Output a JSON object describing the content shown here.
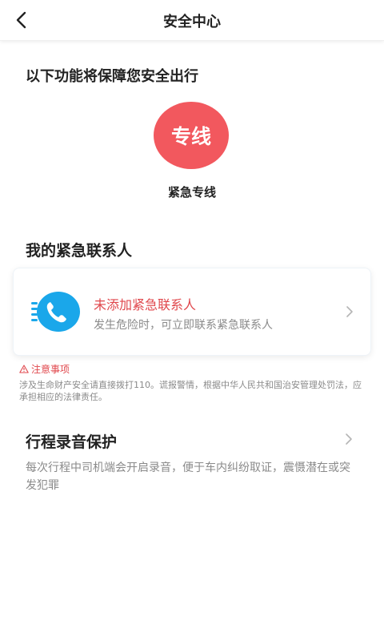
{
  "header": {
    "title": "安全中心",
    "back_icon": "chevron-left-icon"
  },
  "features": {
    "heading": "以下功能将保障您安全出行",
    "hotline": {
      "badge_text": "专线",
      "label": "紧急专线",
      "color": "#f2585e"
    }
  },
  "emergency_contacts": {
    "heading": "我的紧急联系人",
    "card": {
      "icon": "phone-icon",
      "title": "未添加紧急联系人",
      "description": "发生危险时，可立即联系紧急联系人"
    }
  },
  "notice": {
    "heading": "注意事项",
    "body": "涉及生命财产安全请直接拨打110。谎报警情，根据中华人民共和国治安管理处罚法，应承担相应的法律责任。"
  },
  "recording": {
    "title": "行程录音保护",
    "description": "每次行程中司机端会开启录音，便于车内纠纷取证，震慑潜在或突发犯罪"
  },
  "colors": {
    "accent_red": "#e0474c",
    "phone_blue": "#1aa7ea",
    "muted_text": "#8a8a8a"
  }
}
